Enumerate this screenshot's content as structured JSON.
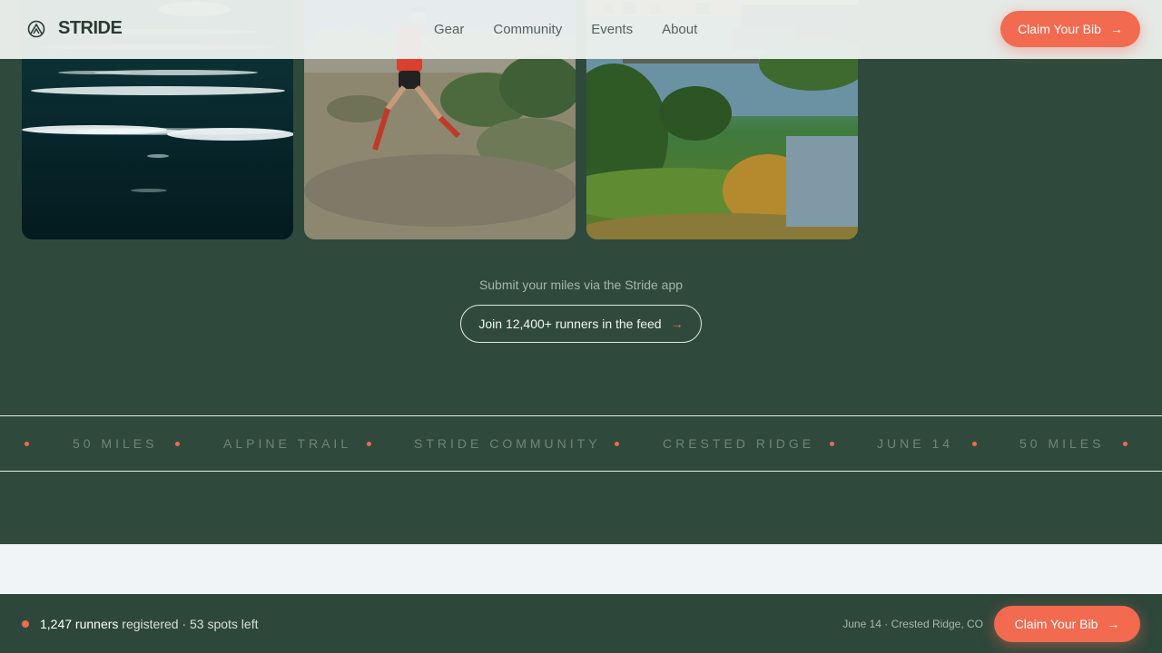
{
  "header": {
    "brand": "STRIDE",
    "nav": [
      "Gear",
      "Community",
      "Events",
      "About"
    ],
    "cta_label": "Claim Your Bib"
  },
  "gallery": {
    "photos": [
      {
        "subject": "water-reflections"
      },
      {
        "subject": "trail-runner"
      },
      {
        "subject": "lakeside-park"
      }
    ]
  },
  "feed": {
    "submit_text": "Submit your miles via the Stride app",
    "join_label": "Join 12,400+ runners in the feed"
  },
  "marquee": {
    "items": [
      "50 MILES",
      "ALPINE TRAIL",
      "STRIDE COMMUNITY",
      "CRESTED RIDGE",
      "JUNE 14",
      "50 MILES"
    ]
  },
  "footer": {
    "runners_count": "1,247 runners",
    "registered_text": "registered · 53 spots left",
    "event_info": "June 14 · Crested Ridge, CO",
    "cta_label": "Claim Your Bib"
  },
  "colors": {
    "accent": "#f26a4f",
    "background": "#2f4a3d",
    "header_bg": "#eceeee",
    "band": "#f1f4f6"
  },
  "icons": {
    "brand": "mountain-logo-icon",
    "cta": "arrow-right-icon"
  }
}
